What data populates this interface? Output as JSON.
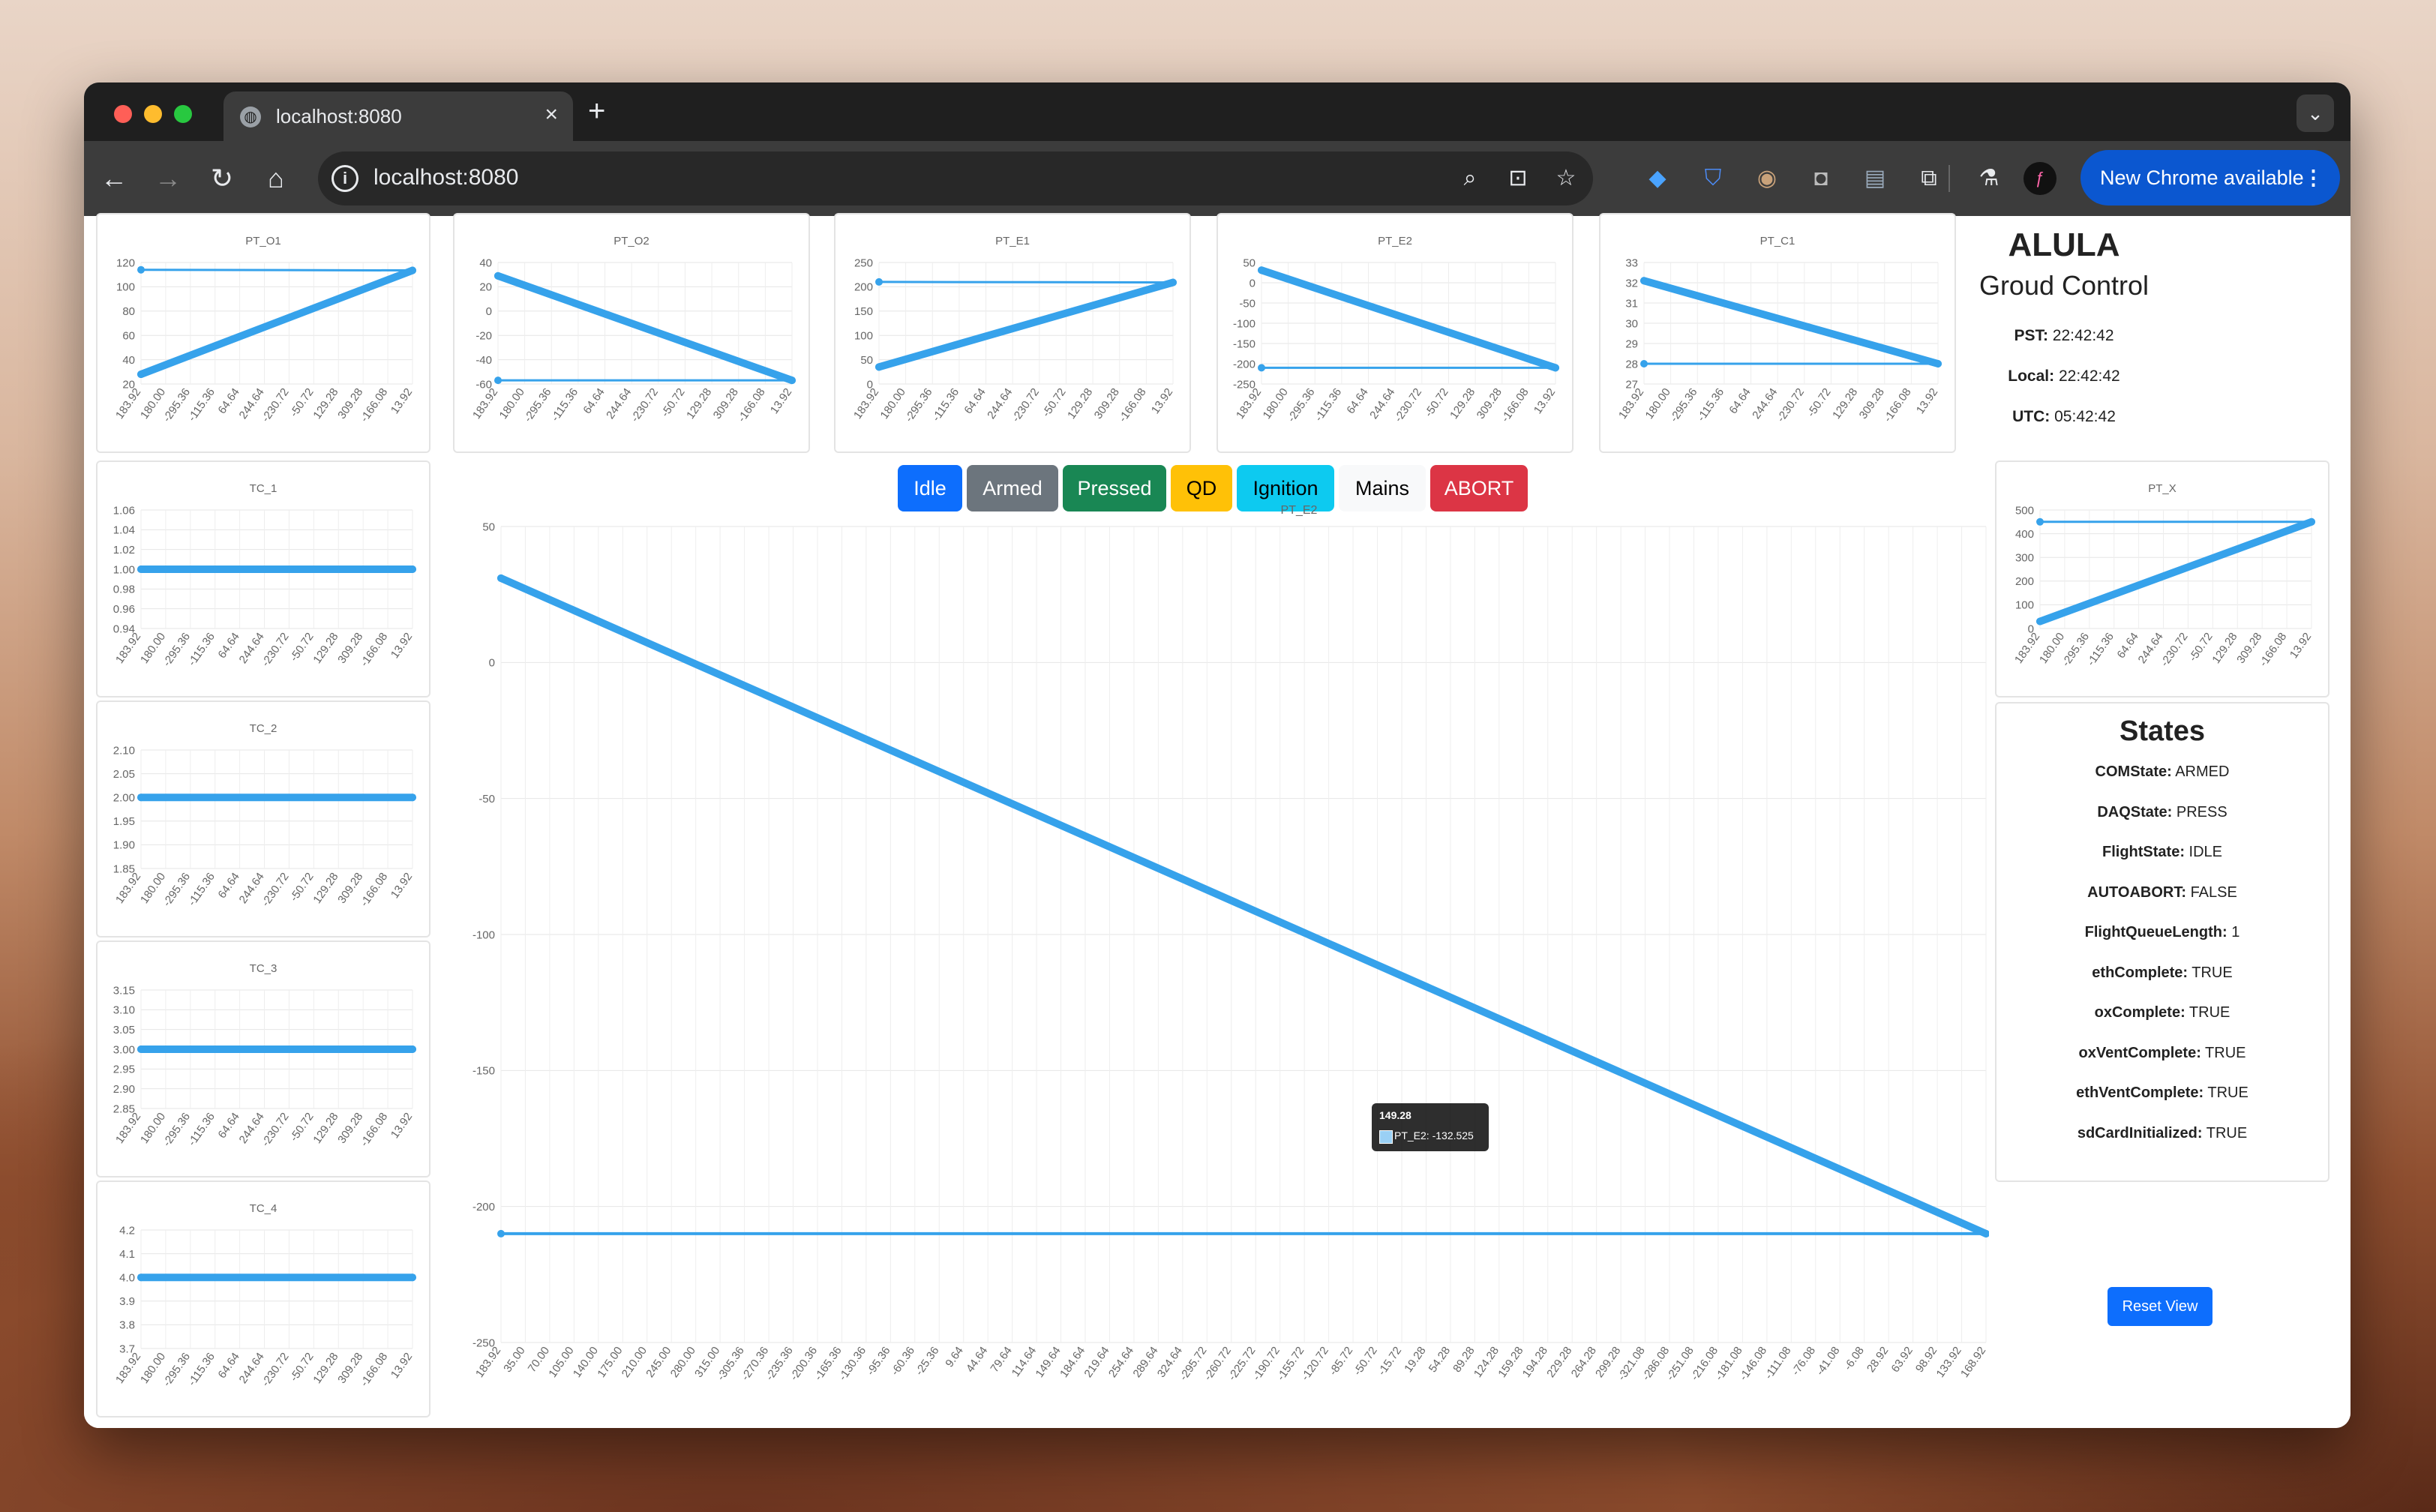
{
  "browser": {
    "tab_title": "localhost:8080",
    "url": "localhost:8080",
    "new_chrome_label": "New Chrome available",
    "new_tab_symbol": "+"
  },
  "header": {
    "title": "ALULA",
    "subtitle": "Groud Control",
    "clocks": [
      {
        "label": "PST:",
        "value": "22:42:42"
      },
      {
        "label": "Local:",
        "value": "22:42:42"
      },
      {
        "label": "UTC:",
        "value": "05:42:42"
      }
    ]
  },
  "state_buttons": [
    {
      "label": "Idle",
      "color": "#0d6efd",
      "text_color": "#ffffff"
    },
    {
      "label": "Armed",
      "color": "#6c757d",
      "text_color": "#ffffff"
    },
    {
      "label": "Pressed",
      "color": "#198754",
      "text_color": "#ffffff"
    },
    {
      "label": "QD",
      "color": "#ffc107",
      "text_color": "#000000"
    },
    {
      "label": "Ignition",
      "color": "#0dcaf0",
      "text_color": "#000000"
    },
    {
      "label": "Mains",
      "color": "#f8f9fa",
      "text_color": "#000000"
    },
    {
      "label": "ABORT",
      "color": "#dc3545",
      "text_color": "#ffffff"
    }
  ],
  "states": {
    "title": "States",
    "items": [
      {
        "label": "COMState:",
        "value": "ARMED"
      },
      {
        "label": "DAQState:",
        "value": "PRESS"
      },
      {
        "label": "FlightState:",
        "value": "IDLE"
      },
      {
        "label": "AUTOABORT:",
        "value": "FALSE"
      },
      {
        "label": "FlightQueueLength:",
        "value": "1"
      },
      {
        "label": "ethComplete:",
        "value": "TRUE"
      },
      {
        "label": "oxComplete:",
        "value": "TRUE"
      },
      {
        "label": "oxVentComplete:",
        "value": "TRUE"
      },
      {
        "label": "ethVentComplete:",
        "value": "TRUE"
      },
      {
        "label": "sdCardInitialized:",
        "value": "TRUE"
      }
    ]
  },
  "reset_label": "Reset View",
  "tooltip": {
    "title": "149.28",
    "body": "PT_E2: -132.525"
  },
  "chart_data": [
    {
      "id": "PT_O1",
      "type": "line",
      "title": "PT_O1",
      "yticks": [
        "120",
        "100",
        "80",
        "60",
        "40",
        "20"
      ],
      "ylim": [
        20,
        120
      ],
      "x": [
        "183.92",
        "180.00",
        "-295.36",
        "-115.36",
        "64.64",
        "244.64",
        "-230.72",
        "-50.72",
        "129.28",
        "309.28",
        "-166.08",
        "13.92"
      ],
      "series": [
        {
          "points": [
            [
              0,
              114
            ],
            [
              1,
              113.5
            ],
            [
              0,
              28
            ]
          ]
        }
      ],
      "color": "#36a2eb"
    },
    {
      "id": "PT_O2",
      "type": "line",
      "title": "PT_O2",
      "yticks": [
        "40",
        "20",
        "0",
        "-20",
        "-40",
        "-60"
      ],
      "ylim": [
        -60,
        40
      ],
      "x": [
        "183.92",
        "180.00",
        "-295.36",
        "-115.36",
        "64.64",
        "244.64",
        "-230.72",
        "-50.72",
        "129.28",
        "309.28",
        "-166.08",
        "13.92"
      ],
      "series": [
        {
          "points": [
            [
              0,
              -57
            ],
            [
              1,
              -57
            ],
            [
              0,
              29
            ]
          ]
        }
      ],
      "color": "#36a2eb"
    },
    {
      "id": "PT_E1",
      "type": "line",
      "title": "PT_E1",
      "yticks": [
        "250",
        "200",
        "150",
        "100",
        "50",
        "0"
      ],
      "ylim": [
        0,
        250
      ],
      "x": [
        "183.92",
        "180.00",
        "-295.36",
        "-115.36",
        "64.64",
        "244.64",
        "-230.72",
        "-50.72",
        "129.28",
        "309.28",
        "-166.08",
        "13.92"
      ],
      "series": [
        {
          "points": [
            [
              0,
              210
            ],
            [
              1,
              209
            ],
            [
              0,
              35
            ]
          ]
        }
      ],
      "color": "#36a2eb"
    },
    {
      "id": "PT_E2",
      "type": "line",
      "title": "PT_E2",
      "yticks": [
        "50",
        "0",
        "-50",
        "-100",
        "-150",
        "-200",
        "-250"
      ],
      "ylim": [
        -250,
        50
      ],
      "x": [
        "183.92",
        "180.00",
        "-295.36",
        "-115.36",
        "64.64",
        "244.64",
        "-230.72",
        "-50.72",
        "129.28",
        "309.28",
        "-166.08",
        "13.92"
      ],
      "series": [
        {
          "points": [
            [
              0,
              -210
            ],
            [
              1,
              -210
            ],
            [
              0,
              31
            ]
          ]
        }
      ],
      "color": "#36a2eb"
    },
    {
      "id": "PT_C1",
      "type": "line",
      "title": "PT_C1",
      "yticks": [
        "33",
        "32",
        "31",
        "30",
        "29",
        "28",
        "27"
      ],
      "ylim": [
        27,
        33
      ],
      "x": [
        "183.92",
        "180.00",
        "-295.36",
        "-115.36",
        "64.64",
        "244.64",
        "-230.72",
        "-50.72",
        "129.28",
        "309.28",
        "-166.08",
        "13.92"
      ],
      "series": [
        {
          "points": [
            [
              0,
              28
            ],
            [
              1,
              28
            ],
            [
              0,
              32.1
            ]
          ]
        }
      ],
      "color": "#36a2eb"
    },
    {
      "id": "TC_1",
      "type": "line",
      "title": "TC_1",
      "yticks": [
        "1.06",
        "1.04",
        "1.02",
        "1.00",
        "0.98",
        "0.96",
        "0.94"
      ],
      "ylim": [
        0.94,
        1.06
      ],
      "x": [
        "183.92",
        "180.00",
        "-295.36",
        "-115.36",
        "64.64",
        "244.64",
        "-230.72",
        "-50.72",
        "129.28",
        "309.28",
        "-166.08",
        "13.92"
      ],
      "series": [
        {
          "points": [
            [
              0,
              1.0
            ],
            [
              1,
              1.0
            ]
          ]
        }
      ],
      "color": "#36a2eb"
    },
    {
      "id": "TC_2",
      "type": "line",
      "title": "TC_2",
      "yticks": [
        "2.10",
        "2.05",
        "2.00",
        "1.95",
        "1.90",
        "1.85"
      ],
      "ylim": [
        1.85,
        2.1
      ],
      "x": [
        "183.92",
        "180.00",
        "-295.36",
        "-115.36",
        "64.64",
        "244.64",
        "-230.72",
        "-50.72",
        "129.28",
        "309.28",
        "-166.08",
        "13.92"
      ],
      "series": [
        {
          "points": [
            [
              0,
              2.0
            ],
            [
              1,
              2.0
            ]
          ]
        }
      ],
      "color": "#36a2eb"
    },
    {
      "id": "TC_3",
      "type": "line",
      "title": "TC_3",
      "yticks": [
        "3.15",
        "3.10",
        "3.05",
        "3.00",
        "2.95",
        "2.90",
        "2.85"
      ],
      "ylim": [
        2.85,
        3.15
      ],
      "x": [
        "183.92",
        "180.00",
        "-295.36",
        "-115.36",
        "64.64",
        "244.64",
        "-230.72",
        "-50.72",
        "129.28",
        "309.28",
        "-166.08",
        "13.92"
      ],
      "series": [
        {
          "points": [
            [
              0,
              3.0
            ],
            [
              1,
              3.0
            ]
          ]
        }
      ],
      "color": "#36a2eb"
    },
    {
      "id": "TC_4",
      "type": "line",
      "title": "TC_4",
      "yticks": [
        "4.2",
        "4.1",
        "4.0",
        "3.9",
        "3.8",
        "3.7"
      ],
      "ylim": [
        3.7,
        4.2
      ],
      "x": [
        "183.92",
        "180.00",
        "-295.36",
        "-115.36",
        "64.64",
        "244.64",
        "-230.72",
        "-50.72",
        "129.28",
        "309.28",
        "-166.08",
        "13.92"
      ],
      "series": [
        {
          "points": [
            [
              0,
              4.0
            ],
            [
              1,
              4.0
            ]
          ]
        }
      ],
      "color": "#36a2eb"
    },
    {
      "id": "PT_X",
      "type": "line",
      "title": "PT_X",
      "yticks": [
        "500",
        "400",
        "300",
        "200",
        "100",
        "0"
      ],
      "ylim": [
        0,
        500
      ],
      "x": [
        "183.92",
        "180.00",
        "-295.36",
        "-115.36",
        "64.64",
        "244.64",
        "-230.72",
        "-50.72",
        "129.28",
        "309.28",
        "-166.08",
        "13.92"
      ],
      "series": [
        {
          "points": [
            [
              0,
              450
            ],
            [
              1,
              450
            ],
            [
              0,
              30
            ]
          ]
        }
      ],
      "color": "#36a2eb"
    },
    {
      "id": "PT_E2_MAIN",
      "type": "line",
      "title": "PT_E2",
      "yticks": [
        "50",
        "0",
        "-50",
        "-100",
        "-150",
        "-200",
        "-250"
      ],
      "ylim": [
        -250,
        50
      ],
      "x": [
        "183.92",
        "35.00",
        "70.00",
        "105.00",
        "140.00",
        "175.00",
        "210.00",
        "245.00",
        "280.00",
        "315.00",
        "-305.36",
        "-270.36",
        "-235.36",
        "-200.36",
        "-165.36",
        "-130.36",
        "-95.36",
        "-60.36",
        "-25.36",
        "9.64",
        "44.64",
        "79.64",
        "114.64",
        "149.64",
        "184.64",
        "219.64",
        "254.64",
        "289.64",
        "324.64",
        "-295.72",
        "-260.72",
        "-225.72",
        "-190.72",
        "-155.72",
        "-120.72",
        "-85.72",
        "-50.72",
        "-15.72",
        "19.28",
        "54.28",
        "89.28",
        "124.28",
        "159.28",
        "194.28",
        "229.28",
        "264.28",
        "299.28",
        "-321.08",
        "-286.08",
        "-251.08",
        "-216.08",
        "-181.08",
        "-146.08",
        "-111.08",
        "-76.08",
        "-41.08",
        "-6.08",
        "28.92",
        "63.92",
        "98.92",
        "133.92",
        "168.92"
      ],
      "series": [
        {
          "points": [
            [
              0,
              -210
            ],
            [
              1,
              -210
            ],
            [
              0,
              31
            ]
          ]
        }
      ],
      "color": "#36a2eb"
    }
  ]
}
